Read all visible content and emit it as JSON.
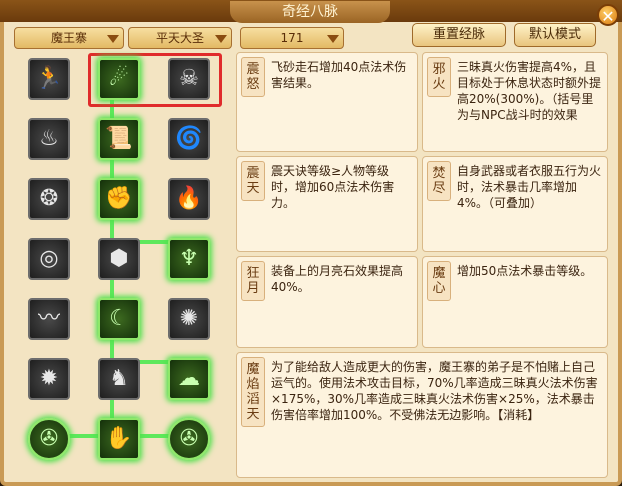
{
  "window": {
    "title": "奇经八脉",
    "close_icon": "close-icon"
  },
  "toolbar": {
    "sect": "魔王寨",
    "school": "平天大圣",
    "points": "171",
    "reset_label": "重置经脉",
    "default_label": "默认模式"
  },
  "tree": {
    "nodes": [
      {
        "id": "r1c1",
        "icon": "running-figure-icon",
        "active": false
      },
      {
        "id": "r1c2",
        "icon": "flying-stones-icon",
        "active": true
      },
      {
        "id": "r1c3",
        "icon": "demon-face-icon",
        "active": false
      },
      {
        "id": "r2c1",
        "icon": "smoke-icon",
        "active": false
      },
      {
        "id": "r2c2",
        "icon": "scroll-icon",
        "active": true
      },
      {
        "id": "r2c3",
        "icon": "swirl-icon",
        "active": false
      },
      {
        "id": "r3c1",
        "icon": "seal-icon",
        "active": false
      },
      {
        "id": "r3c2",
        "icon": "stone-fist-icon",
        "active": true
      },
      {
        "id": "r3c3",
        "icon": "fire-icon",
        "active": false
      },
      {
        "id": "r4c1",
        "icon": "medallion-icon",
        "active": false
      },
      {
        "id": "r4c2",
        "icon": "rock-icon",
        "active": false
      },
      {
        "id": "r4c3",
        "icon": "flame-wall-icon",
        "active": true
      },
      {
        "id": "r5c1",
        "icon": "serpent-icon",
        "active": false
      },
      {
        "id": "r5c2",
        "icon": "moon-icon",
        "active": true
      },
      {
        "id": "r5c3",
        "icon": "blaze-icon",
        "active": false
      },
      {
        "id": "r6c1",
        "icon": "inferno-icon",
        "active": false
      },
      {
        "id": "r6c2",
        "icon": "beast-icon",
        "active": false
      },
      {
        "id": "r6c3",
        "icon": "cloud-icon",
        "active": true
      },
      {
        "id": "r7c1",
        "icon": "spiral-icon",
        "active": true
      },
      {
        "id": "r7c2",
        "icon": "claw-icon",
        "active": true
      },
      {
        "id": "r7c3",
        "icon": "spiral-icon",
        "active": true
      }
    ]
  },
  "skills": [
    {
      "name": "震怒",
      "desc": "飞砂走石增加40点法术伤害结果。"
    },
    {
      "name": "邪火",
      "desc": "三昧真火伤害提高4%，且目标处于休息状态时额外提高20%(300%)。（括号里为与NPC战斗时的效果"
    },
    {
      "name": "震天",
      "desc": "震天诀等级≥人物等级时，增加60点法术伤害力。"
    },
    {
      "name": "焚尽",
      "desc": "自身武器或者衣服五行为火时，法术暴击几率增加4%。（可叠加）"
    },
    {
      "name": "狂月",
      "desc": "装备上的月亮石效果提高40%。"
    },
    {
      "name": "魔心",
      "desc": "增加50点法术暴击等级。"
    },
    {
      "name": "魔焰滔天",
      "desc": "为了能给敌人造成更大的伤害，魔王寨的弟子是不怕赌上自己运气的。使用法术攻击目标，70%几率造成三昧真火法术伤害×175%，30%几率造成三昧真火法术伤害×25%，法术暴击伤害倍率增加100%。不受佛法无边影响。【消耗】"
    }
  ]
}
